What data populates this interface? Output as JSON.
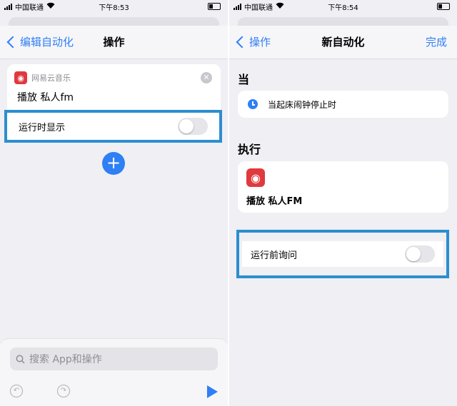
{
  "left": {
    "status": {
      "carrier": "中国联通",
      "time": "下午8:53"
    },
    "nav": {
      "back_label": "编辑自动化",
      "title": "操作"
    },
    "action": {
      "app_name": "网易云音乐",
      "action_name": "播放 私人fm",
      "show_when_run_label": "运行时显示",
      "show_when_run_on": false
    },
    "search": {
      "placeholder": "搜索 App和操作"
    }
  },
  "right": {
    "status": {
      "carrier": "中国联通",
      "time": "下午8:54"
    },
    "nav": {
      "back_label": "操作",
      "title": "新自动化",
      "done_label": "完成"
    },
    "when": {
      "heading": "当",
      "trigger": "当起床闹钟停止时"
    },
    "do": {
      "heading": "执行",
      "action_name": "播放 私人FM"
    },
    "ask_before_running": {
      "label": "运行前询问",
      "on": false
    }
  },
  "colors": {
    "accent": "#2f7ff5",
    "highlight_box": "#2c8ecf",
    "app_red": "#e0393e"
  },
  "icons": [
    "signal-icon",
    "wifi-icon",
    "battery-icon",
    "chevron-left-icon",
    "netease-music-icon",
    "close-icon",
    "plus-icon",
    "search-icon",
    "undo-icon",
    "redo-icon",
    "play-icon",
    "alarm-clock-icon"
  ]
}
